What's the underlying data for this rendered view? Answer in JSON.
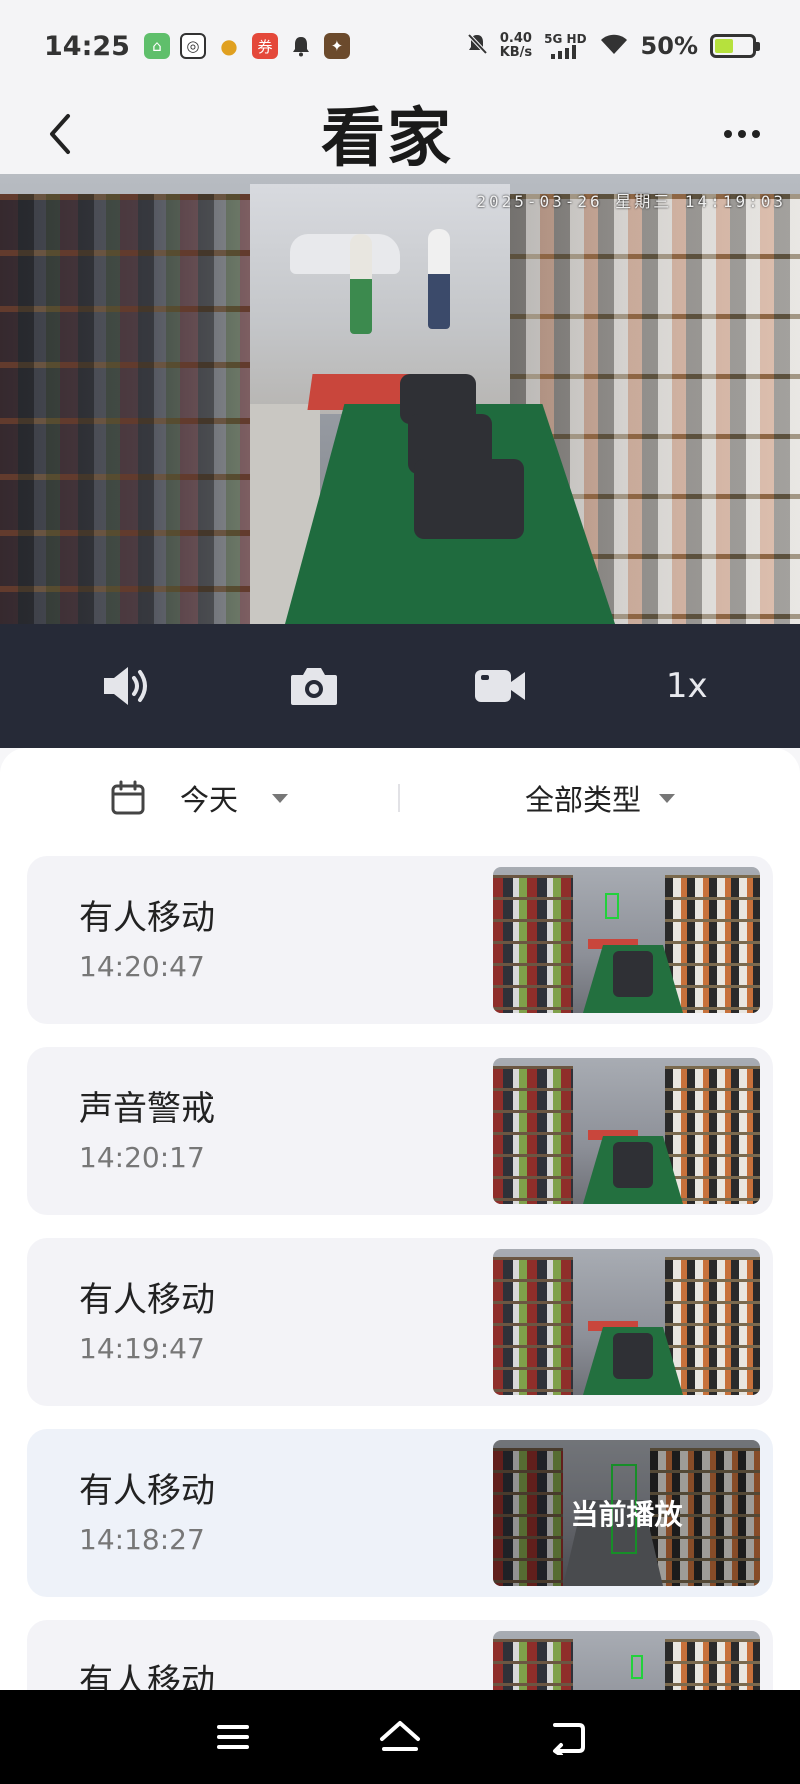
{
  "status_bar": {
    "time": "14:25",
    "net_speed_value": "0.40",
    "net_speed_unit": "KB/s",
    "signal_label": "5G HD",
    "battery_percent": "50%",
    "battery_level": 0.5,
    "app_icons": [
      "green-app-icon",
      "qq-app-icon",
      "colorful-app-icon",
      "red-app-icon",
      "bell-icon",
      "game-app-icon"
    ]
  },
  "header": {
    "title": "看家",
    "back_icon": "chevron-left-icon",
    "more_icon": "more-dots-icon"
  },
  "video": {
    "timestamp": "2025-03-26 星期三 14:19:03"
  },
  "controls": {
    "volume_icon": "speaker-icon",
    "snapshot_icon": "camera-icon",
    "record_icon": "video-camera-icon",
    "speed_label": "1x"
  },
  "filters": {
    "date_label": "今天",
    "type_label": "全部类型"
  },
  "events": [
    {
      "title": "有人移动",
      "time": "14:20:47",
      "current": false
    },
    {
      "title": "声音警戒",
      "time": "14:20:17",
      "current": false
    },
    {
      "title": "有人移动",
      "time": "14:19:47",
      "current": false
    },
    {
      "title": "有人移动",
      "time": "14:18:27",
      "current": true,
      "overlay": "当前播放"
    },
    {
      "title": "有人移动",
      "time": "",
      "current": false
    }
  ],
  "colors": {
    "controls_bg": "#262a37",
    "panel_bg": "#ffffff",
    "card_bg": "#f3f3f7",
    "detection_box": "#22d13b"
  }
}
